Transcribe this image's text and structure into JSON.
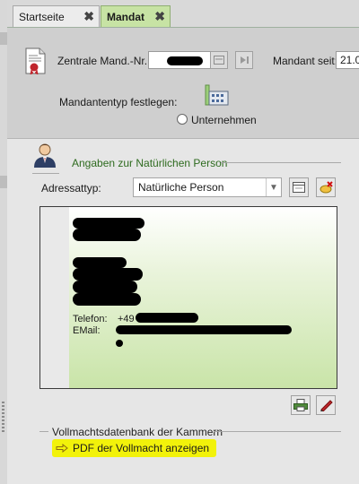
{
  "tabs": [
    {
      "label": "Startseite",
      "close": "✖",
      "active": false
    },
    {
      "label": "Mandat",
      "close": "✖",
      "active": true
    }
  ],
  "header": {
    "mand_nr_label": "Zentrale Mand.-Nr.:",
    "mandant_seit_label": "Mandant seit:",
    "mandant_seit_value": "21.0",
    "mandantentyp_label": "Mandantentyp festlegen:",
    "radio_unternehmen_label": "Unternehmen"
  },
  "person_section": {
    "title": "Angaben zur Natürlichen Person",
    "adressattyp_label": "Adressattyp:",
    "adressattyp_value": "Natürliche Person",
    "address": {
      "telefon_label": "Telefon:",
      "telefon_prefix": "+49",
      "email_label": "EMail:"
    }
  },
  "vollmacht_section": {
    "title": "Vollmachtsdatenbank der Kammern",
    "link_label": "PDF der Vollmacht anzeigen",
    "highlight_color": "#f2f20a"
  },
  "icons": [
    "document-seal-icon",
    "calendar-icon",
    "skip-end-icon",
    "building-icon",
    "person-icon",
    "card-icon",
    "card-delete-icon",
    "print-icon",
    "edit-icon",
    "arrow-right-icon"
  ],
  "colors": {
    "active_tab": "#c7e3a4",
    "section_title": "#2e6b1f"
  }
}
